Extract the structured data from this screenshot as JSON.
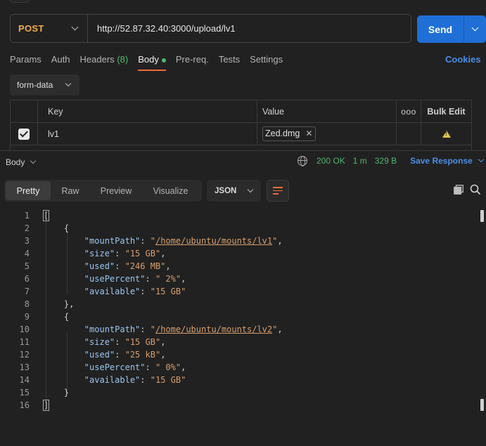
{
  "request": {
    "method": "POST",
    "url": "http://52.87.32.40:3000/upload/lv1",
    "send_label": "Send"
  },
  "tabs": [
    {
      "label": "Params"
    },
    {
      "label": "Auth"
    },
    {
      "label": "Headers",
      "count": "(8)"
    },
    {
      "label": "Body",
      "active": true
    },
    {
      "label": "Pre-req."
    },
    {
      "label": "Tests"
    },
    {
      "label": "Settings"
    }
  ],
  "cookies_label": "Cookies",
  "body_type": "form-data",
  "kv_table": {
    "headers": {
      "key": "Key",
      "value": "Value",
      "more": "ooo",
      "bulk_edit": "Bulk Edit"
    },
    "rows": [
      {
        "checked": true,
        "key": "lv1",
        "value_file": "Zed.dmg",
        "warning": true
      }
    ]
  },
  "response": {
    "section_label": "Body",
    "status": "200 OK",
    "time": "1 m",
    "size": "329 B",
    "save_label": "Save Response",
    "view_tabs": [
      "Pretty",
      "Raw",
      "Preview",
      "Visualize"
    ],
    "active_view": "Pretty",
    "format": "JSON"
  },
  "code_lines": [
    {
      "n": "1",
      "text": "["
    },
    {
      "n": "2",
      "text": "    {"
    },
    {
      "n": "3",
      "key": "mountPath",
      "value": "/home/ubuntu/mounts/lv1",
      "link": true,
      "comma": true
    },
    {
      "n": "4",
      "key": "size",
      "value": "15 GB",
      "comma": true
    },
    {
      "n": "5",
      "key": "used",
      "value": "246 MB",
      "comma": true
    },
    {
      "n": "6",
      "key": "usePercent",
      "value": " 2%",
      "comma": true
    },
    {
      "n": "7",
      "key": "available",
      "value": "15 GB",
      "comma": false
    },
    {
      "n": "8",
      "text": "    },"
    },
    {
      "n": "9",
      "text": "    {"
    },
    {
      "n": "10",
      "key": "mountPath",
      "value": "/home/ubuntu/mounts/lv2",
      "link": true,
      "comma": true
    },
    {
      "n": "11",
      "key": "size",
      "value": "15 GB",
      "comma": true
    },
    {
      "n": "12",
      "key": "used",
      "value": "25 kB",
      "comma": true
    },
    {
      "n": "13",
      "key": "usePercent",
      "value": " 0%",
      "comma": true
    },
    {
      "n": "14",
      "key": "available",
      "value": "15 GB",
      "comma": false
    },
    {
      "n": "15",
      "text": "    }"
    },
    {
      "n": "16",
      "text": "]"
    }
  ],
  "colors": {
    "method": "#f0ad4e",
    "send": "#1f6fd6",
    "accent_tab": "#ef6a3a",
    "status_ok": "#4fb86a",
    "link": "#4b8ee8",
    "json_key": "#9cc6ef",
    "json_string": "#d89f6c"
  },
  "icons": [
    "chevron-down-icon",
    "check-icon",
    "close-icon",
    "warning-icon",
    "globe-icon",
    "wrap-lines-icon",
    "copy-icon",
    "search-icon"
  ]
}
